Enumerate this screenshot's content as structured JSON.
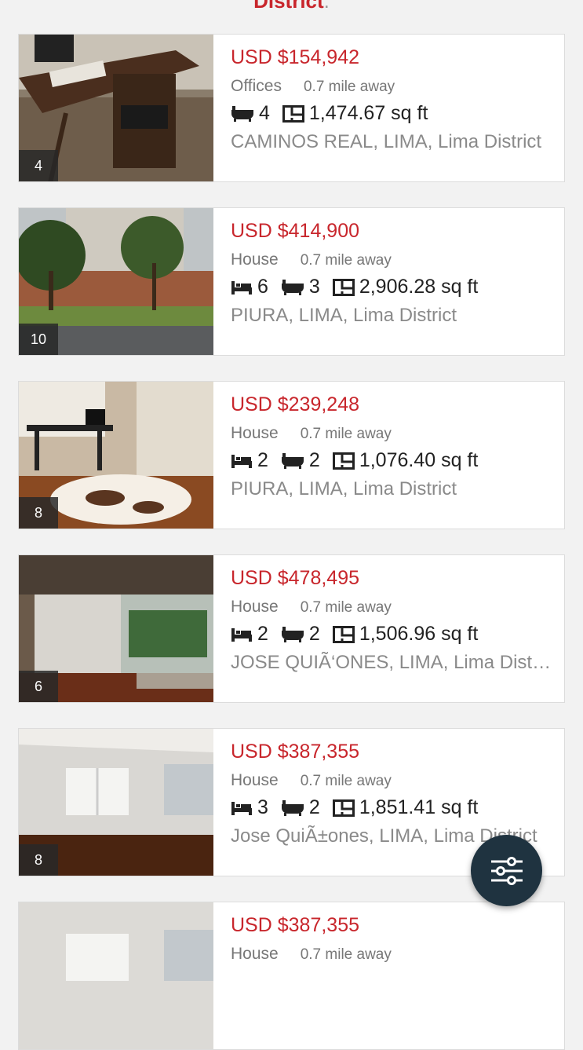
{
  "header": {
    "title_partial": "District",
    "title_suffix": "."
  },
  "listings": [
    {
      "photo_count": "4",
      "price": "USD $154,942",
      "type": "Offices",
      "distance": "0.7 mile away",
      "bedrooms": null,
      "bathrooms": "4",
      "area": "1,474.67 sq ft",
      "address": "CAMINOS REAL, LIMA, Lima District"
    },
    {
      "photo_count": "10",
      "price": "USD $414,900",
      "type": "House",
      "distance": "0.7 mile away",
      "bedrooms": "6",
      "bathrooms": "3",
      "area": "2,906.28 sq ft",
      "address": "PIURA, LIMA, Lima District"
    },
    {
      "photo_count": "8",
      "price": "USD $239,248",
      "type": "House",
      "distance": "0.7 mile away",
      "bedrooms": "2",
      "bathrooms": "2",
      "area": "1,076.40 sq ft",
      "address": "PIURA, LIMA, Lima District"
    },
    {
      "photo_count": "6",
      "price": "USD $478,495",
      "type": "House",
      "distance": "0.7 mile away",
      "bedrooms": "2",
      "bathrooms": "2",
      "area": "1,506.96 sq ft",
      "address": "JOSE QUIÃ‘ONES, LIMA, Lima District"
    },
    {
      "photo_count": "8",
      "price": "USD $387,355",
      "type": "House",
      "distance": "0.7 mile away",
      "bedrooms": "3",
      "bathrooms": "2",
      "area": "1,851.41 sq ft",
      "address": "Jose QuiÃ±ones, LIMA, Lima District"
    },
    {
      "photo_count": "",
      "price": "USD $387,355",
      "type": "House",
      "distance": "0.7 mile away",
      "bedrooms": null,
      "bathrooms": null,
      "area": null,
      "address": ""
    }
  ],
  "fab": {
    "icon": "filter-sliders-icon"
  },
  "colors": {
    "price": "#c8262c",
    "fab": "#1f3340",
    "background": "#f2f2f2"
  }
}
